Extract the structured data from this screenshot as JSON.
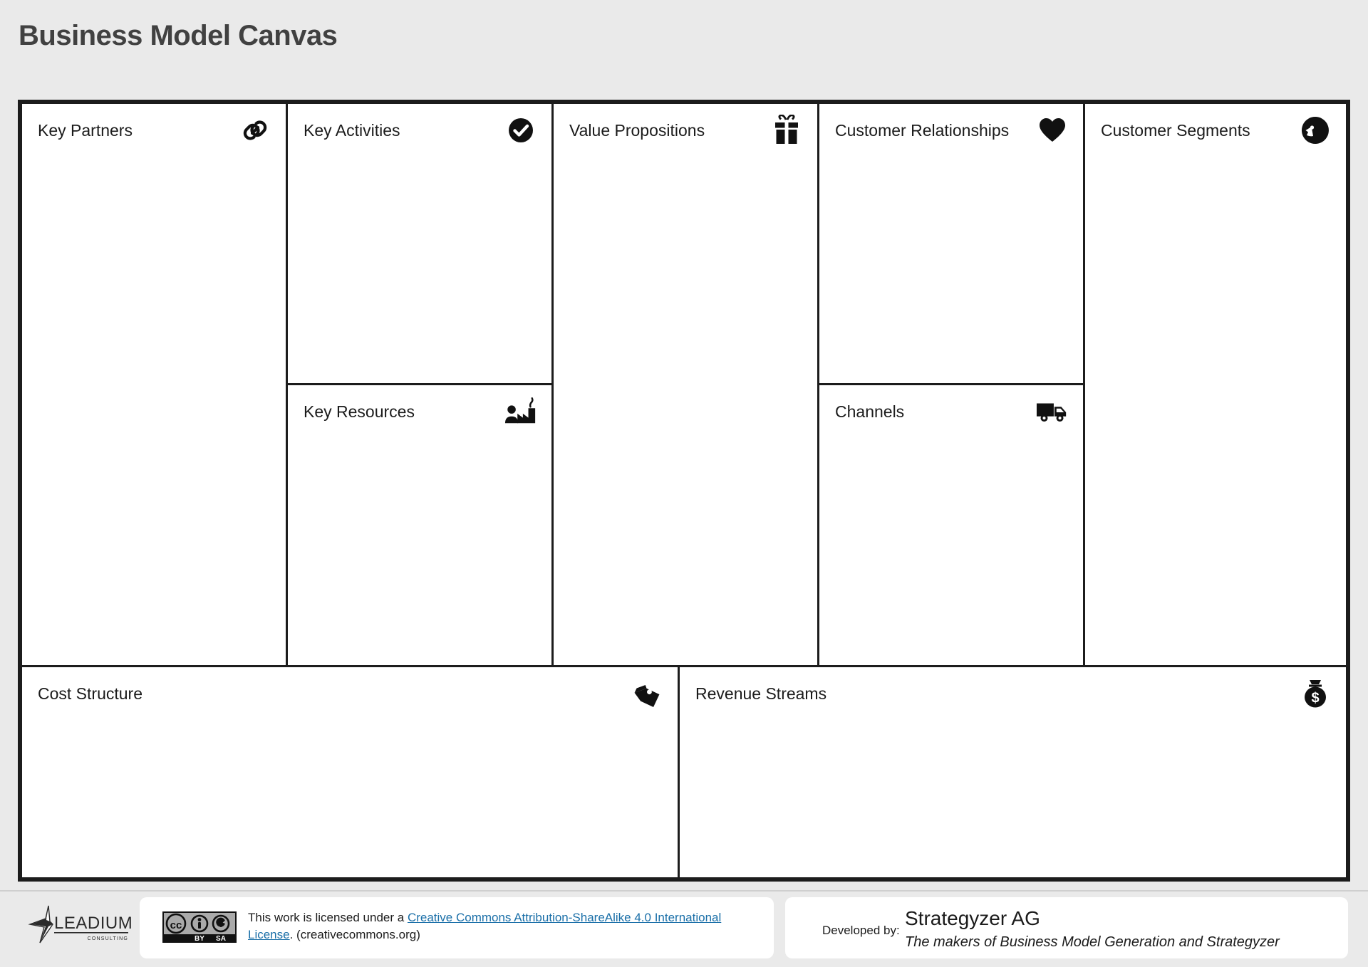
{
  "page": {
    "title": "Business Model Canvas",
    "background_color": "#eaeaea",
    "frame_color": "#1c1c1c"
  },
  "canvas": {
    "blocks": [
      {
        "key": "key_partners",
        "label": "Key Partners",
        "icon": "chain-link-icon"
      },
      {
        "key": "key_activities",
        "label": "Key Activities",
        "icon": "check-circle-icon"
      },
      {
        "key": "key_resources",
        "label": "Key Resources",
        "icon": "factory-worker-icon"
      },
      {
        "key": "value_propositions",
        "label": "Value Propositions",
        "icon": "gift-box-icon"
      },
      {
        "key": "customer_relationships",
        "label": "Customer Relationships",
        "icon": "heart-icon"
      },
      {
        "key": "channels",
        "label": "Channels",
        "icon": "delivery-truck-icon"
      },
      {
        "key": "customer_segments",
        "label": "Customer Segments",
        "icon": "person-head-icon"
      },
      {
        "key": "cost_structure",
        "label": "Cost Structure",
        "icon": "price-tag-icon"
      },
      {
        "key": "revenue_streams",
        "label": "Revenue Streams",
        "icon": "money-bag-icon"
      }
    ]
  },
  "footer": {
    "logo": {
      "name": "LEADIUM",
      "subtitle": "CONSULTING"
    },
    "license": {
      "badge_labels": {
        "by": "BY",
        "sa": "SA",
        "cc": "cc"
      },
      "prefix": "This work is licensed under a ",
      "link_text": "Creative Commons Attribution-ShareAlike 4.0 International License",
      "suffix": ". (creativecommons.org)"
    },
    "developed": {
      "label": "Developed by:",
      "name": "Strategyzer AG",
      "tagline": "The makers of Business Model Generation and Strategyzer"
    }
  }
}
